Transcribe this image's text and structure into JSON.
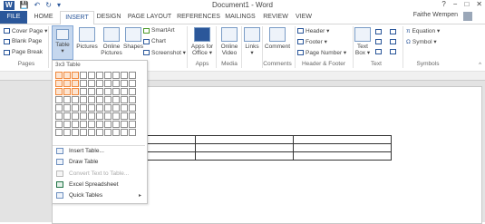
{
  "window": {
    "title": "Document1 - Word",
    "help": "?",
    "controls": [
      "−",
      "□",
      "✕"
    ],
    "user": "Faithe Wempen"
  },
  "quick_access": {
    "save": "💾",
    "undo": "↶",
    "redo": "↻",
    "customize": "▾"
  },
  "tabs": {
    "file": "FILE",
    "home": "HOME",
    "insert": "INSERT",
    "design": "DESIGN",
    "page_layout": "PAGE LAYOUT",
    "references": "REFERENCES",
    "mailings": "MAILINGS",
    "review": "REVIEW",
    "view": "VIEW"
  },
  "ribbon": {
    "pages": {
      "cover_page": "Cover Page ▾",
      "blank_page": "Blank Page",
      "page_break": "Page Break",
      "label": "Pages"
    },
    "table": {
      "label": "Table",
      "arrow": "▾"
    },
    "illustrations": {
      "pictures": "Pictures",
      "online": "Online",
      "pictures2": "Pictures",
      "shapes": "Shapes",
      "smartart": "SmartArt",
      "chart": "Chart",
      "screenshot": "Screenshot ▾"
    },
    "apps": {
      "line1": "Apps for",
      "line2": "Office ▾",
      "label": "Apps"
    },
    "media": {
      "line1": "Online",
      "line2": "Video",
      "label": "Media"
    },
    "links": {
      "label_btn": "Links",
      "arrow": "▾"
    },
    "comments": {
      "comment": "Comment",
      "label": "Comments"
    },
    "header_footer": {
      "header": "Header ▾",
      "footer": "Footer ▾",
      "page_number": "Page Number ▾",
      "label": "Header & Footer"
    },
    "text": {
      "line1": "Text",
      "line2": "Box ▾",
      "label": "Text"
    },
    "symbols": {
      "equation": "Equation ▾",
      "symbol": "Symbol ▾",
      "label": "Symbols"
    }
  },
  "table_menu": {
    "title": "3x3 Table",
    "items": [
      {
        "label": "Insert Table...",
        "enabled": true
      },
      {
        "label": "Draw Table",
        "enabled": true
      },
      {
        "label": "Convert Text to Table...",
        "enabled": false
      },
      {
        "label": "Excel Spreadsheet",
        "enabled": true
      },
      {
        "label": "Quick Tables",
        "enabled": true,
        "submenu": "▸"
      }
    ],
    "grid_selection": {
      "rows": 3,
      "cols": 3
    }
  },
  "colors": {
    "accent": "#2b579a",
    "highlight": "#f0883b"
  }
}
